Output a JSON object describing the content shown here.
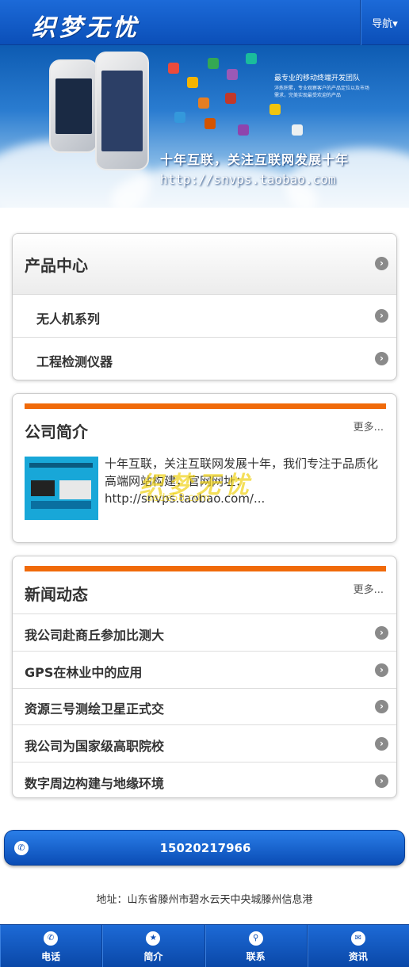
{
  "header": {
    "logo": "织梦无忧",
    "nav_label": "导航▾"
  },
  "banner": {
    "team_line": "最专业的移动终端开发团队",
    "small_text": "淬炼积累，专业观察客户的产品定位以及市场需求，完美实现最受欢迎的产品",
    "title": "十年互联，关注互联网发展十年",
    "url": "http://snvps.taobao.com"
  },
  "products": {
    "title": "产品中心",
    "items": [
      {
        "label": "无人机系列"
      },
      {
        "label": "工程检测仪器"
      }
    ]
  },
  "about": {
    "title": "公司简介",
    "more": "更多...",
    "text": "十年互联，关注互联网发展十年，我们专注于品质化高端网站构建，官网网址：http://snvps.taobao.com/...",
    "watermark": "织梦无忧",
    "watermark_sub": "dede58.com"
  },
  "news": {
    "title": "新闻动态",
    "more": "更多...",
    "items": [
      {
        "label": "我公司赴商丘参加比测大"
      },
      {
        "label": "GPS在林业中的应用"
      },
      {
        "label": "资源三号测绘卫星正式交"
      },
      {
        "label": "我公司为国家级高职院校"
      },
      {
        "label": "数字周边构建与地缘环境"
      }
    ]
  },
  "call": {
    "phone": "15020217966"
  },
  "footer": {
    "address": "地址：山东省滕州市碧水云天中央城滕州信息港"
  },
  "bottom_nav": [
    {
      "label": "电话",
      "icon": "phone-icon"
    },
    {
      "label": "简介",
      "icon": "star-icon"
    },
    {
      "label": "联系",
      "icon": "location-pin-icon"
    },
    {
      "label": "资讯",
      "icon": "message-icon"
    }
  ],
  "colors": {
    "brand_blue": "#0b4fb8",
    "accent_orange": "#f06a0a"
  }
}
